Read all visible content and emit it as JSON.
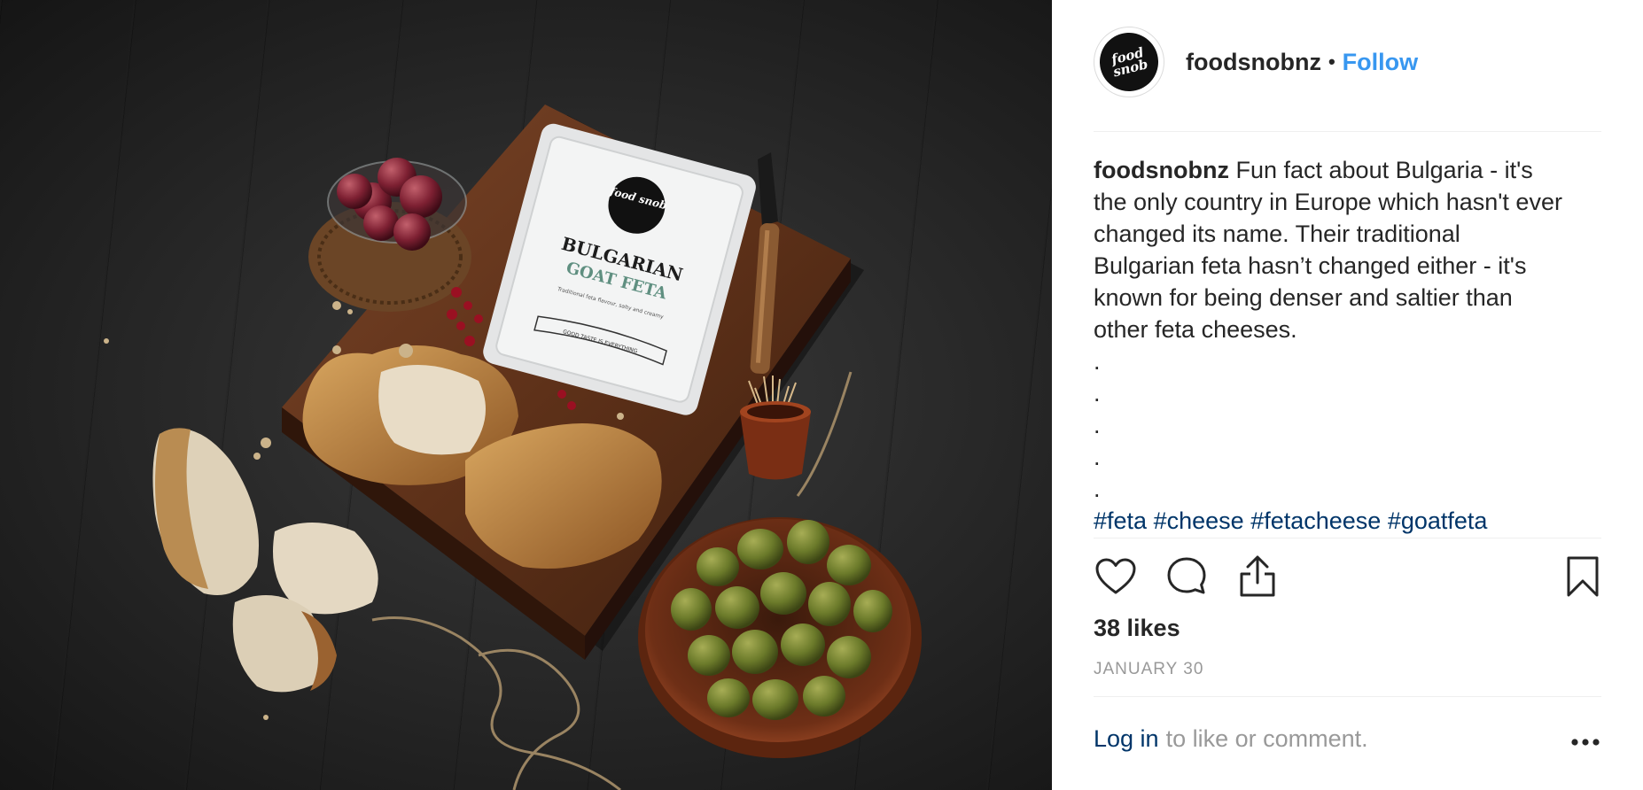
{
  "post": {
    "username": "foodsnobnz",
    "separator": "•",
    "follow_label": "Follow",
    "avatar_text": "food snob"
  },
  "photo": {
    "package_brand": "food snob",
    "package_title_line1": "BULGARIAN",
    "package_title_line2": "GOAT FETA",
    "package_subtitle": "Traditional feta flavour, salty and creamy",
    "package_ribbon": "GOOD TASTE IS EVERYTHING"
  },
  "caption": {
    "username": "foodsnobnz",
    "lines": [
      " Fun fact about Bulgaria - it's",
      "the only country in Europe which hasn't ever",
      "changed its name. Their traditional",
      "Bulgarian feta hasn’t changed either - it's",
      "known for being denser and saltier than",
      "other feta cheeses."
    ],
    "dots": [
      ".",
      ".",
      ".",
      ".",
      "."
    ],
    "hashtags": [
      "#feta",
      "#cheese",
      "#fetacheese",
      "#goatfeta"
    ]
  },
  "actions": {
    "icons": [
      "heart-icon",
      "comment-icon",
      "share-icon",
      "bookmark-icon"
    ]
  },
  "likes": "38 likes",
  "date": "JANUARY 30",
  "footer": {
    "login_link": "Log in",
    "login_rest": "to like or comment.",
    "more_label": "•••"
  },
  "colors": {
    "link_blue": "#3897f0",
    "dark_link": "#003569",
    "muted": "#999999",
    "text": "#262626",
    "divider": "#efefef"
  }
}
